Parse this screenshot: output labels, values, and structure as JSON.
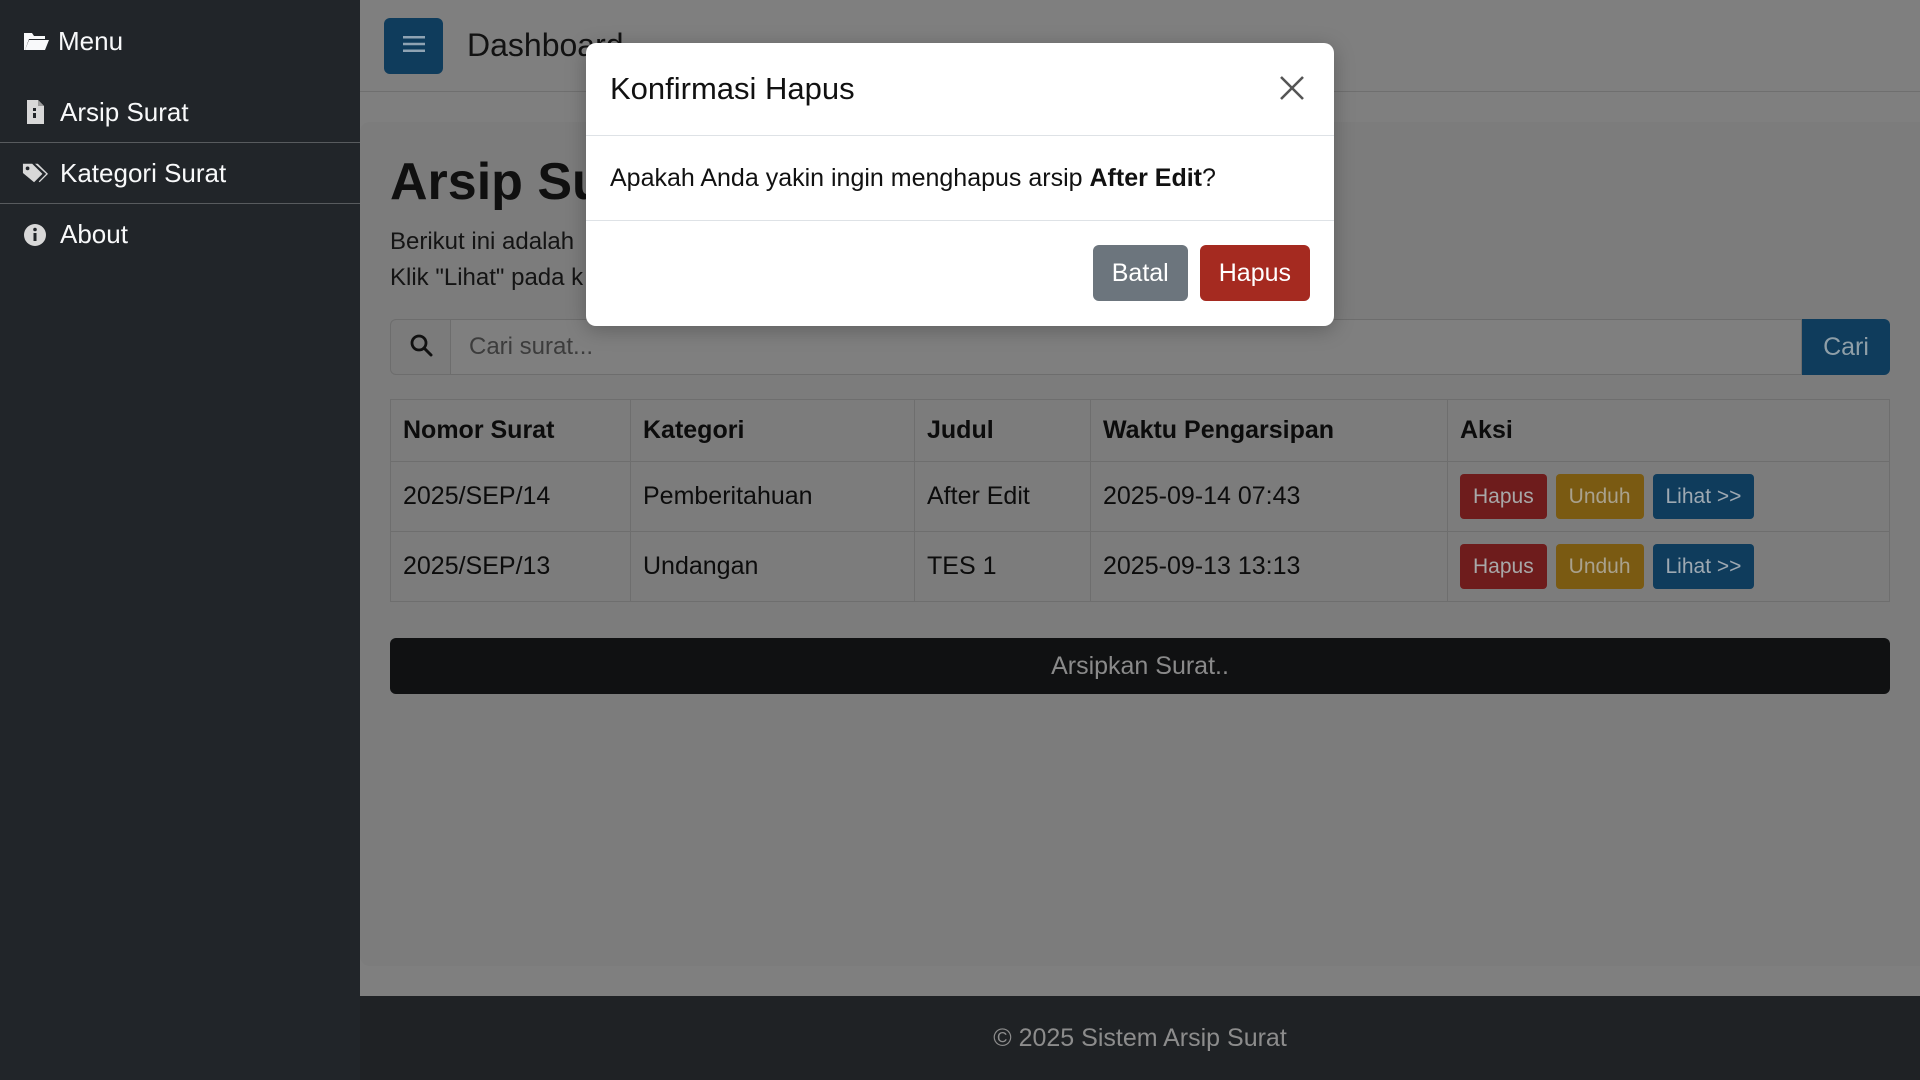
{
  "sidebar": {
    "header": {
      "icon": "folder-open-icon",
      "label": "Menu"
    },
    "items": [
      {
        "icon": "file-icon",
        "label": "Arsip Surat"
      },
      {
        "icon": "tags-icon",
        "label": "Kategori Surat"
      },
      {
        "icon": "info-icon",
        "label": "About"
      }
    ]
  },
  "topbar": {
    "toggle_icon": "hamburger-icon",
    "title": "Dashboard"
  },
  "page": {
    "title": "Arsip Surat",
    "desc_line1": "Berikut ini adalah",
    "desc_line2": "Klik \"Lihat\" pada k"
  },
  "search": {
    "icon": "search-icon",
    "placeholder": "Cari surat...",
    "button_label": "Cari"
  },
  "table": {
    "headers": [
      "Nomor Surat",
      "Kategori",
      "Judul",
      "Waktu Pengarsipan",
      "Aksi"
    ],
    "rows": [
      {
        "nomor": "2025/SEP/14",
        "kategori": "Pemberitahuan",
        "judul": "After Edit",
        "waktu": "2025-09-14 07:43"
      },
      {
        "nomor": "2025/SEP/13",
        "kategori": "Undangan",
        "judul": "TES 1",
        "waktu": "2025-09-13 13:13"
      }
    ],
    "actions": {
      "delete": "Hapus",
      "download": "Unduh",
      "view": "Lihat >>"
    }
  },
  "archive_button": "Arsipkan Surat..",
  "footer": "© 2025 Sistem Arsip Surat",
  "modal": {
    "title": "Konfirmasi Hapus",
    "close_icon": "close-icon",
    "message_prefix": "Apakah Anda yakin ingin menghapus arsip ",
    "message_target": "After Edit",
    "message_suffix": "?",
    "cancel_label": "Batal",
    "confirm_label": "Hapus"
  },
  "colors": {
    "sidebar_bg": "#212529",
    "primary": "#0f3c5c",
    "danger": "#a52a20",
    "secondary": "#6c757d",
    "footer_bg": "#1f2225"
  }
}
